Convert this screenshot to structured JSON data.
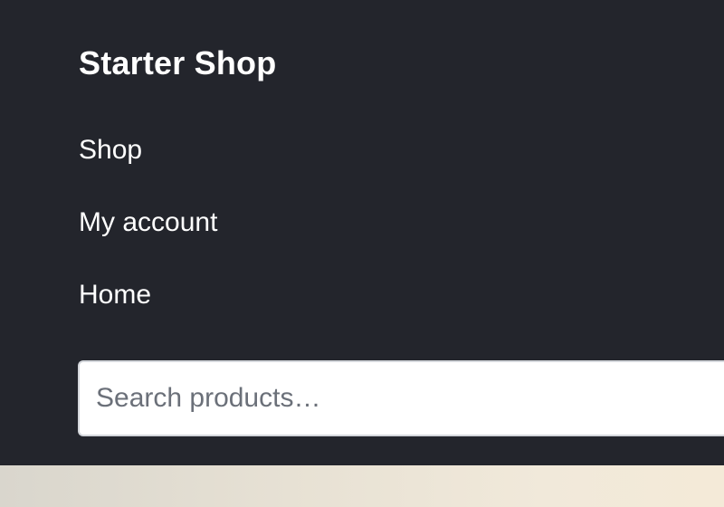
{
  "header": {
    "site_title": "Starter Shop",
    "nav": [
      {
        "label": "Shop"
      },
      {
        "label": "My account"
      },
      {
        "label": "Home"
      }
    ]
  },
  "search": {
    "value": "",
    "placeholder": "Search products…"
  },
  "colors": {
    "header_bg": "#23252c",
    "text": "#ffffff",
    "input_bg": "#ffffff",
    "input_border": "#d4d7dc",
    "placeholder": "#6b7079"
  }
}
